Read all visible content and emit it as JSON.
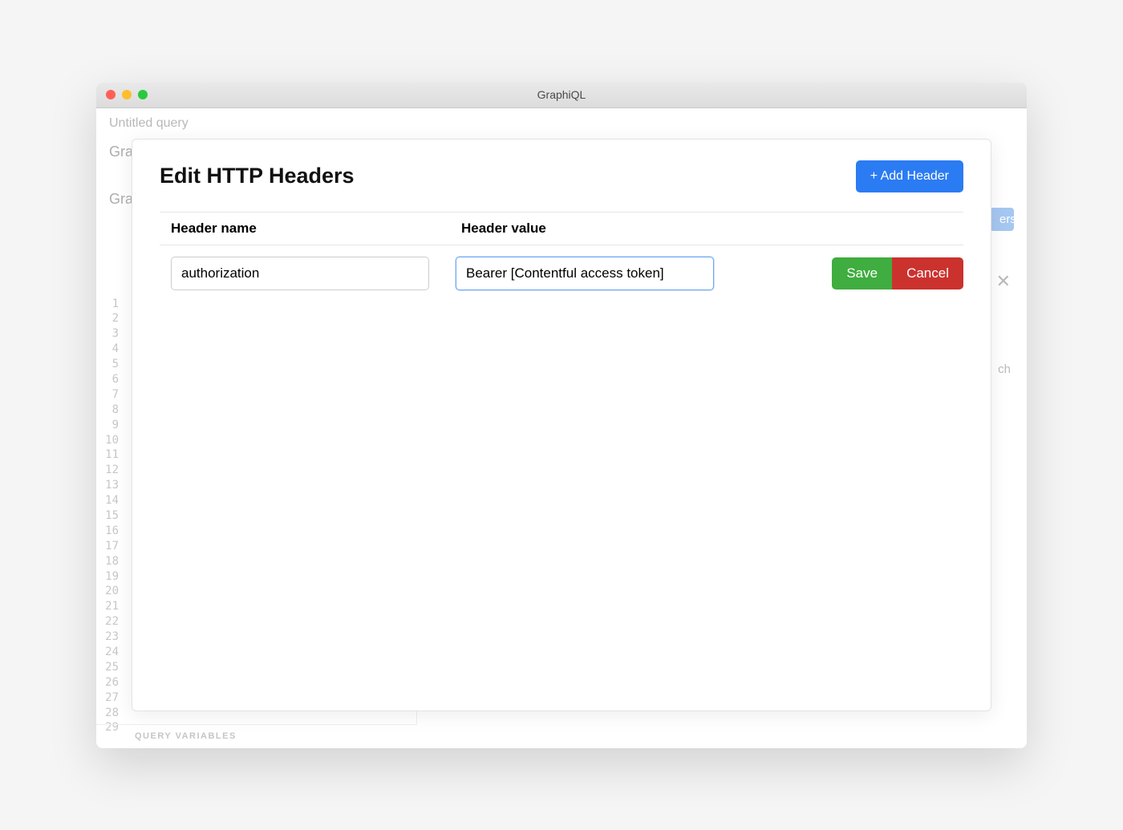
{
  "window": {
    "title": "GraphiQL"
  },
  "query": {
    "name": "Untitled query",
    "bg_left_1": "Grap",
    "bg_left_2": "Gra",
    "gutter_lines": [
      "1",
      "2",
      "3",
      "4",
      "5",
      "6",
      "7",
      "8",
      "9",
      "10",
      "11",
      "12",
      "13",
      "14",
      "15",
      "16",
      "17",
      "18",
      "19",
      "20",
      "21",
      "22",
      "23",
      "24",
      "25",
      "26",
      "27",
      "28",
      "29"
    ]
  },
  "toolbar": {
    "edit_headers_label": "ers"
  },
  "docs": {
    "close_glyph": "✕",
    "search_fragment": "ch"
  },
  "query_variables_label": "QUERY VARIABLES",
  "modal": {
    "title": "Edit HTTP Headers",
    "add_header_label": "+ Add Header",
    "columns": {
      "name": "Header name",
      "value": "Header value"
    },
    "row": {
      "name": "authorization",
      "value": "Bearer [Contentful access token]"
    },
    "save_label": "Save",
    "cancel_label": "Cancel"
  }
}
